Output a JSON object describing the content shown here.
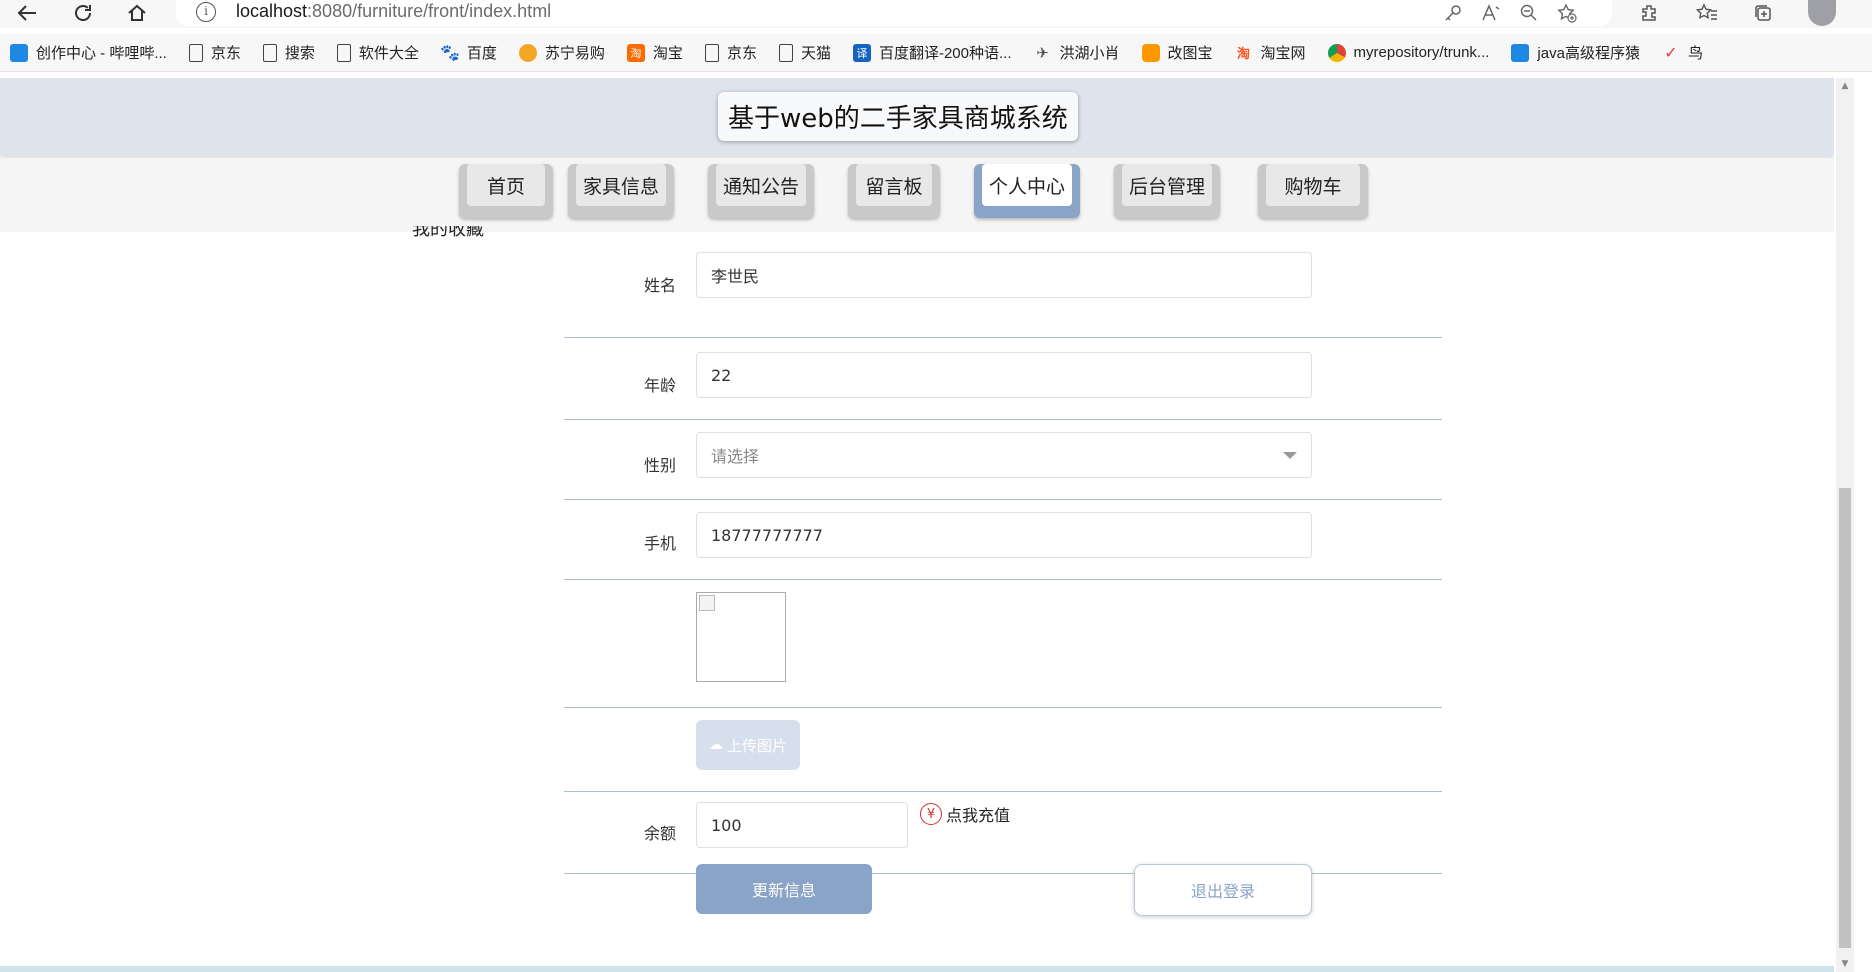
{
  "browser": {
    "url_host": "localhost",
    "url_rest": ":8080/furniture/front/index.html",
    "bookmarks": [
      {
        "label": "创作中心 - 哔哩哔...",
        "icon": "tv-icon",
        "cls": "ico-tv"
      },
      {
        "label": "京东",
        "icon": "page-icon",
        "cls": "ico-page"
      },
      {
        "label": "搜索",
        "icon": "page-icon",
        "cls": "ico-page"
      },
      {
        "label": "软件大全",
        "icon": "page-icon",
        "cls": "ico-page"
      },
      {
        "label": "百度",
        "icon": "paw-icon",
        "cls": "ico-paw"
      },
      {
        "label": "苏宁易购",
        "icon": "lion-icon",
        "cls": "ico-su"
      },
      {
        "label": "淘宝",
        "icon": "taobao-icon",
        "cls": "ico-tao"
      },
      {
        "label": "京东",
        "icon": "page-icon",
        "cls": "ico-page"
      },
      {
        "label": "天猫",
        "icon": "page-icon",
        "cls": "ico-page"
      },
      {
        "label": "百度翻译-200种语...",
        "icon": "translate-icon",
        "cls": "ico-yi"
      },
      {
        "label": "洪湖小肖",
        "icon": "bird-icon",
        "cls": "ico-bird"
      },
      {
        "label": "改图宝",
        "icon": "gaitubao-icon",
        "cls": "ico-gai"
      },
      {
        "label": "淘宝网",
        "icon": "taobao-icon",
        "cls": "ico-tao2"
      },
      {
        "label": "myrepository/trunk...",
        "icon": "chrome-icon",
        "cls": "ico-chrome"
      },
      {
        "label": "java高级程序猿",
        "icon": "tv-icon",
        "cls": "ico-java"
      },
      {
        "label": "鸟",
        "icon": "bird-red-icon",
        "cls": "ico-niao"
      }
    ]
  },
  "site": {
    "title": "基于web的二手家具商城系统"
  },
  "nav": [
    {
      "label": "首页",
      "active": false
    },
    {
      "label": "家具信息",
      "active": false
    },
    {
      "label": "通知公告",
      "active": false
    },
    {
      "label": "留言板",
      "active": false
    },
    {
      "label": "个人中心",
      "active": true
    },
    {
      "label": "后台管理",
      "active": false
    },
    {
      "label": "购物车",
      "active": false
    }
  ],
  "sidebar_cut_text": "我的收藏",
  "form": {
    "name_label": "姓名",
    "name_value": "李世民",
    "age_label": "年龄",
    "age_value": "22",
    "gender_label": "性别",
    "gender_placeholder": "请选择",
    "phone_label": "手机",
    "phone_value": "18777777777",
    "upload_label": "上传图片",
    "balance_label": "余额",
    "balance_value": "100",
    "recharge_label": "点我充值",
    "update_label": "更新信息",
    "logout_label": "退出登录"
  },
  "colors": {
    "accent": "#8aa4c8",
    "header_bg": "#dfe4ec",
    "recharge_red": "#d32f2f"
  }
}
